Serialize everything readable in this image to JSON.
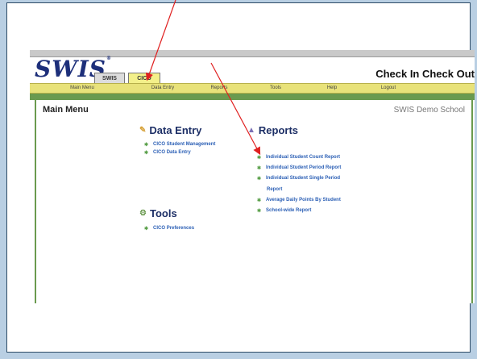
{
  "app": {
    "logo": "SWIS",
    "logo_tm": "®",
    "tabs": [
      "SWIS",
      "CICO"
    ],
    "title": "Check In Check Out"
  },
  "menubar": [
    "Main Menu",
    "Data Entry",
    "Reports",
    "Tools",
    "Help",
    "Logout"
  ],
  "panel": {
    "title": "Main Menu",
    "school": "SWIS Demo School"
  },
  "data_entry": {
    "heading": "Data Entry",
    "links": [
      "CICO Student Management",
      "CICO Data Entry"
    ]
  },
  "tools": {
    "heading": "Tools",
    "links": [
      "CICO Preferences"
    ]
  },
  "reports": {
    "heading": "Reports",
    "links": [
      "Individual Student Count Report",
      "Individual Student Period Report",
      "Individual Student Single Period",
      "Report",
      "Average Daily Points By Student",
      "School-wide Report"
    ]
  },
  "colors": {
    "annotation_arrow": "#e02020",
    "menubar": "#e8e27a",
    "accent_green": "#6a9a4f",
    "link": "#2b5fb5"
  }
}
